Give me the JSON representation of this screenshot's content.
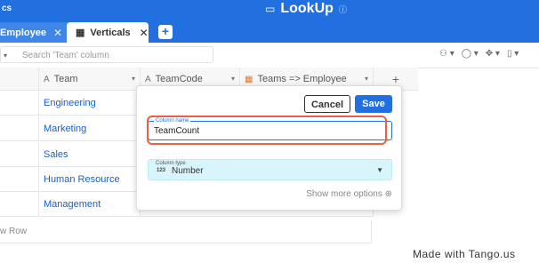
{
  "topbar": {
    "app_name": "cs",
    "title": "LookUp",
    "folder_icon": "folder-icon",
    "info_icon": "info-icon"
  },
  "tabs": [
    {
      "label": "Employee",
      "close": "✕"
    },
    {
      "label": "Verticals",
      "close": "✕"
    }
  ],
  "add_tab": "+",
  "toolbar": {
    "search_placeholder": "Search 'Team' column",
    "tools": [
      "⚇ ▾",
      "◯ ▾",
      "✥ ▾",
      "▯ ▾"
    ]
  },
  "columns": [
    {
      "label": "Team",
      "icon": "A"
    },
    {
      "label": "TeamCode",
      "icon": "A"
    },
    {
      "label": "Teams => Employee",
      "icon": "▦"
    },
    {
      "label": "+",
      "icon": ""
    }
  ],
  "rows": [
    "Engineering",
    "Marketing",
    "Sales",
    "Human Resource",
    "Management"
  ],
  "new_row_label": "w Row",
  "popup": {
    "cancel_label": "Cancel",
    "save_label": "Save",
    "column_name_label": "Column name",
    "column_name_value": "TeamCount",
    "column_type_label": "Column type",
    "column_type_icon": "123",
    "column_type_value": "Number",
    "show_more_label": "Show more options ⊕"
  },
  "watermark": "Made with Tango.us",
  "colors": {
    "brand": "#2270e0",
    "highlight": "#e8604a",
    "type_field": "#d8f5fb"
  }
}
